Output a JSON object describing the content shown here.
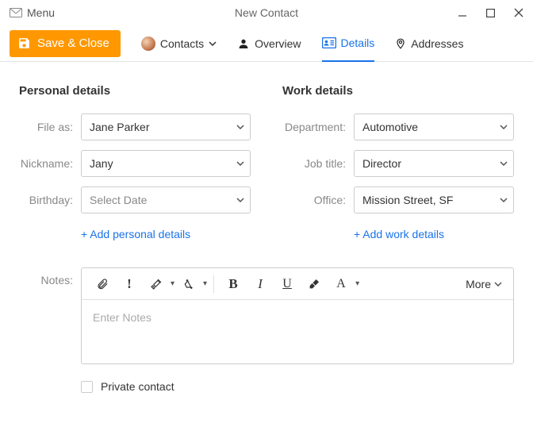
{
  "titlebar": {
    "menu_label": "Menu",
    "title": "New Contact"
  },
  "toolbar": {
    "save_label": "Save & Close",
    "contacts_label": "Contacts",
    "overview_label": "Overview",
    "details_label": "Details",
    "addresses_label": "Addresses"
  },
  "personal": {
    "heading": "Personal details",
    "file_as_label": "File as:",
    "file_as_value": "Jane Parker",
    "nickname_label": "Nickname:",
    "nickname_value": "Jany",
    "birthday_label": "Birthday:",
    "birthday_value": "Select Date",
    "add_link": "+ Add personal details"
  },
  "work": {
    "heading": "Work details",
    "department_label": "Department:",
    "department_value": "Automotive",
    "jobtitle_label": "Job title:",
    "jobtitle_value": "Director",
    "office_label": "Office:",
    "office_value": "Mission Street, SF",
    "add_link": "+ Add work details"
  },
  "notes": {
    "label": "Notes:",
    "placeholder": "Enter Notes",
    "more_label": "More"
  },
  "private": {
    "label": "Private contact",
    "checked": false
  }
}
